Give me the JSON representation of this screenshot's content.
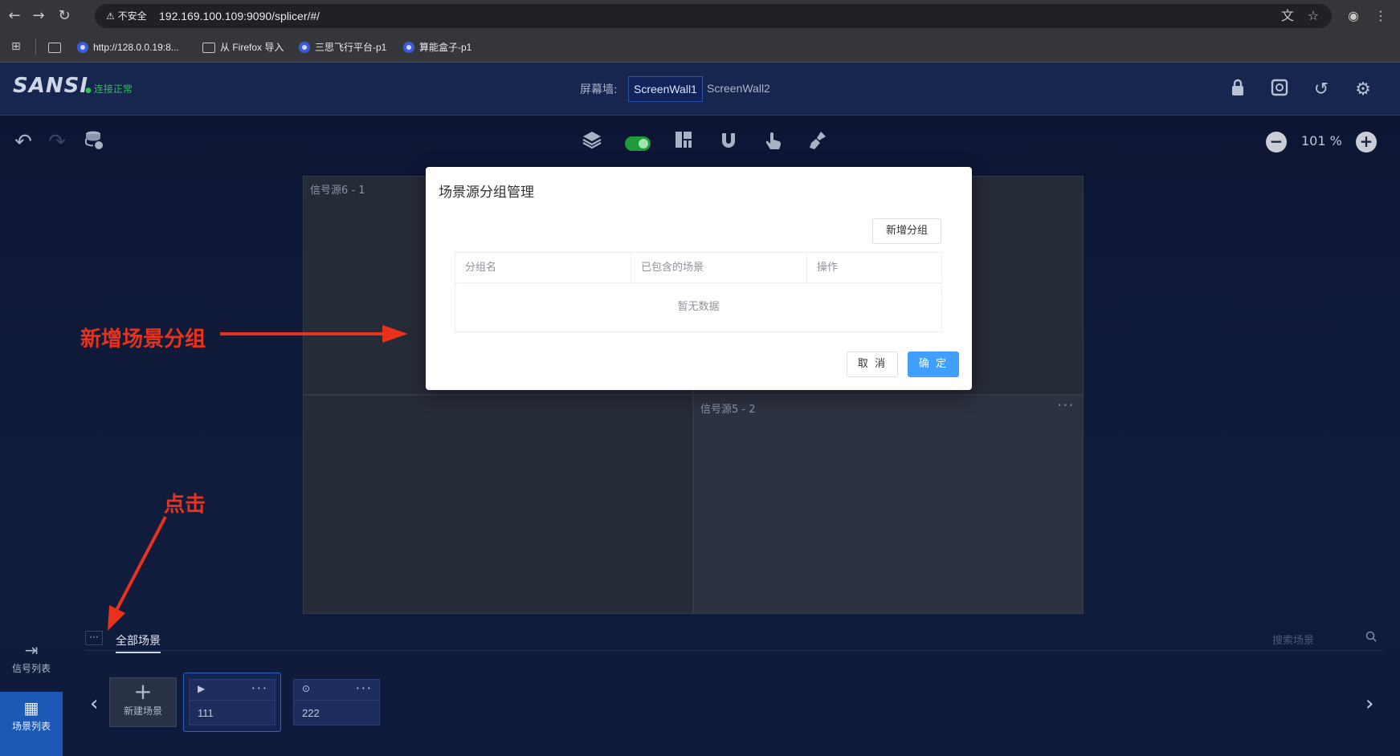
{
  "browser": {
    "security_label": "不安全",
    "url": "192.169.100.109:9090/splicer/#/",
    "bookmarks": [
      {
        "label": "http://128.0.0.19:8..."
      },
      {
        "label": "从 Firefox 导入"
      },
      {
        "label": "三思飞行平台-p1"
      },
      {
        "label": "算能盒子-p1"
      }
    ]
  },
  "header": {
    "logo": "SANSI",
    "connection_status": "连接正常",
    "screen_wall_label": "屏幕墙:",
    "screen_walls": [
      "ScreenWall1",
      "ScreenWall2"
    ]
  },
  "toolbar": {
    "zoom_level": "101 %"
  },
  "canvas": {
    "cells": [
      {
        "title": "信号源6 - 1"
      },
      {
        "title": "信号源5 - 2",
        "more": "···"
      }
    ]
  },
  "modal": {
    "title": "场景源分组管理",
    "add_group_label": "新增分组",
    "columns": [
      "分组名",
      "已包含的场景",
      "操作"
    ],
    "empty_text": "暂无数据",
    "cancel_label": "取 消",
    "ok_label": "确 定"
  },
  "annotations": {
    "add_scene_group": "新增场景分组",
    "click": "点击"
  },
  "bottom": {
    "nav": [
      {
        "label": "信号列表",
        "icon": "signal-list-icon"
      },
      {
        "label": "场景列表",
        "icon": "scene-list-icon"
      }
    ],
    "more_label": "···",
    "tab_all": "全部场景",
    "search_placeholder": "搜索场景",
    "new_scene_label": "新建场景",
    "scenes": [
      {
        "name": "111",
        "icon": "play-icon"
      },
      {
        "name": "222",
        "icon": "record-icon"
      }
    ]
  },
  "colors": {
    "accent": "#409eff",
    "annotation": "#e8321c",
    "connected": "#2fbf55"
  }
}
